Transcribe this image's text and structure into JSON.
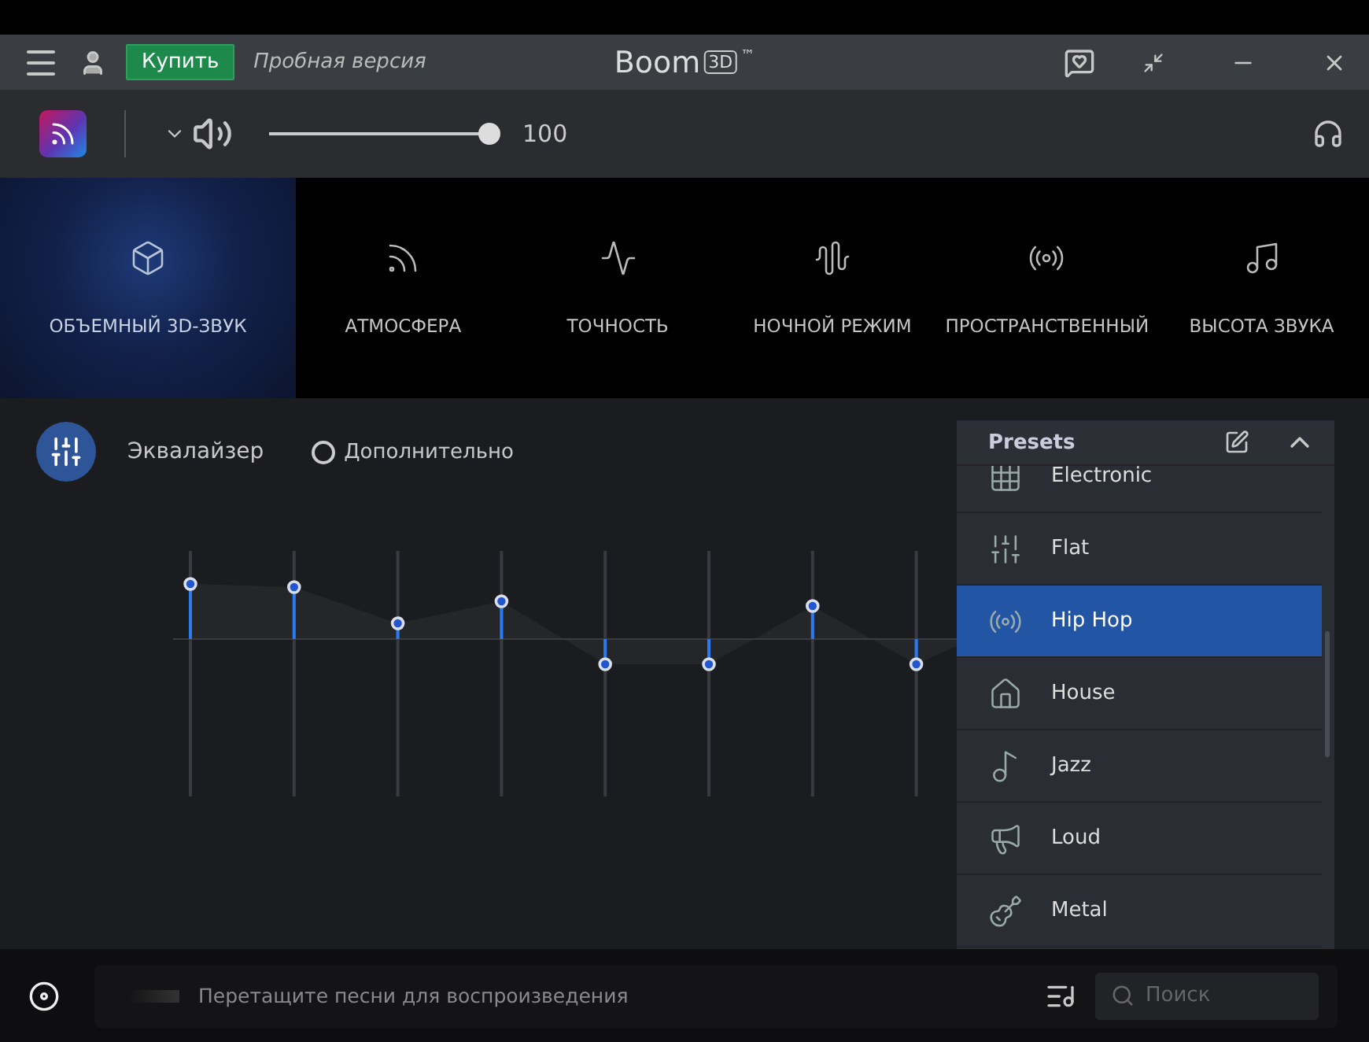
{
  "title_bar": {
    "buy_button": "Купить",
    "trial_label": "Пробная версия",
    "app_name": "Boom",
    "app_badge": "3D",
    "trademark": "™"
  },
  "toolbar": {
    "volume": {
      "level": 1.0,
      "reading": "100"
    }
  },
  "modes": [
    {
      "label": "ОБЪЕМНЫЙ 3D-ЗВУК",
      "selected": true
    },
    {
      "label": "АТМОСФЕРА",
      "selected": false
    },
    {
      "label": "ТОЧНОСТЬ",
      "selected": false
    },
    {
      "label": "НОЧНОЙ РЕЖИМ",
      "selected": false
    },
    {
      "label": "ПРОСТРАНСТВЕННЫЙ",
      "selected": false
    },
    {
      "label": "ВЫСОТА ЗВУКА",
      "selected": false
    }
  ],
  "equalizer": {
    "title": "Эквалайзер",
    "advanced": {
      "label": "Дополнительно",
      "checked": false
    },
    "bands": [
      {
        "level": 0.675
      },
      {
        "level": 0.665
      },
      {
        "level": 0.55
      },
      {
        "level": 0.62
      },
      {
        "level": 0.42
      },
      {
        "level": 0.42
      },
      {
        "level": 0.605
      },
      {
        "level": 0.42
      }
    ]
  },
  "presets": {
    "title": "Presets",
    "items": [
      {
        "label": "Electronic",
        "selected": false
      },
      {
        "label": "Flat",
        "selected": false
      },
      {
        "label": "Hip Hop",
        "selected": true
      },
      {
        "label": "House",
        "selected": false
      },
      {
        "label": "Jazz",
        "selected": false
      },
      {
        "label": "Loud",
        "selected": false
      },
      {
        "label": "Metal",
        "selected": false
      }
    ]
  },
  "bottom_bar": {
    "drop_hint": "Перетащите песни для воспроизведения",
    "search": {
      "placeholder": "Поиск"
    }
  }
}
